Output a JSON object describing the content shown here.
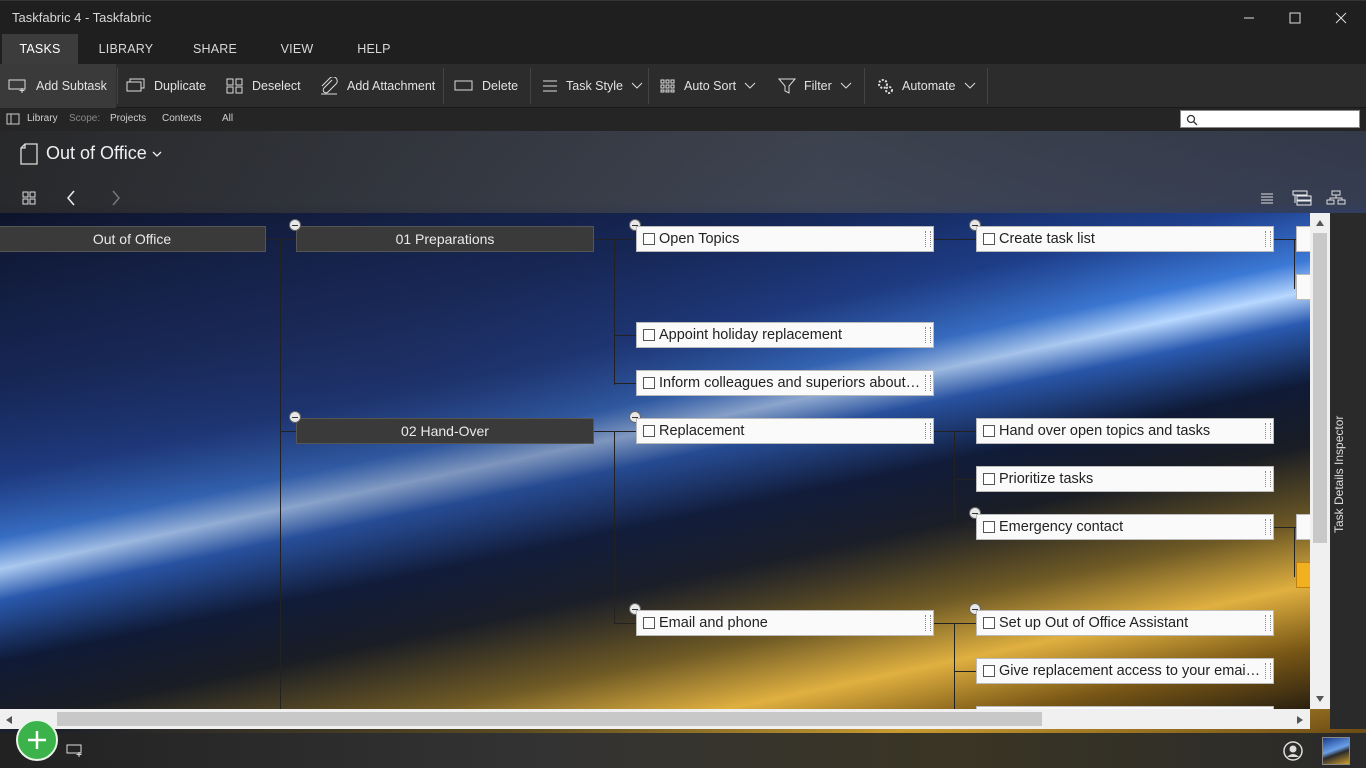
{
  "window": {
    "title": "Taskfabric 4 - Taskfabric"
  },
  "ribbon_tabs": [
    {
      "label": "TASKS",
      "active": true
    },
    {
      "label": "LIBRARY",
      "active": false
    },
    {
      "label": "SHARE",
      "active": false
    },
    {
      "label": "VIEW",
      "active": false
    },
    {
      "label": "HELP",
      "active": false
    }
  ],
  "toolbar": {
    "add_subtask": "Add Subtask",
    "duplicate": "Duplicate",
    "deselect": "Deselect",
    "add_attachment": "Add Attachment",
    "delete": "Delete",
    "task_style": "Task Style",
    "auto_sort": "Auto Sort",
    "filter": "Filter",
    "automate": "Automate"
  },
  "scopebar": {
    "library": "Library",
    "scope_label": "Scope:",
    "projects": "Projects",
    "contexts": "Contexts",
    "all": "All"
  },
  "project": {
    "title": "Out of Office"
  },
  "mindmap": {
    "root": "Out of Office",
    "groups": [
      {
        "label": "01 Preparations"
      },
      {
        "label": "02 Hand-Over"
      }
    ],
    "tasks": {
      "open_topics": "Open Topics",
      "appoint": "Appoint holiday replacement",
      "inform": "Inform colleagues and superiors about upcoming absence",
      "replacement": "Replacement",
      "email_phone": "Email and phone",
      "create_task_list": "Create task list",
      "hand_over": "Hand over open topics and tasks",
      "prioritize": "Prioritize tasks",
      "emergency": "Emergency contact",
      "setup_ooo": "Set up Out of Office Assistant",
      "give_access": "Give replacement access to your email and calendar"
    }
  },
  "inspector": {
    "label": "Task Details Inspector"
  },
  "colors": {
    "accent": "#3c3c3c",
    "fab": "#3bb34a",
    "toolbar": "#2c2c2c"
  }
}
